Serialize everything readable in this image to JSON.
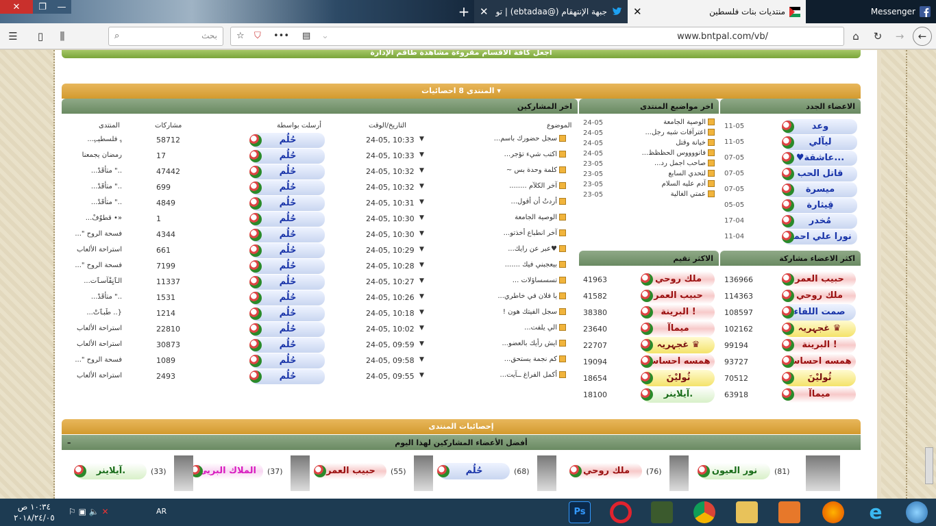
{
  "browser": {
    "tabs": [
      {
        "label": "جبهة الإنتهقام (@ebtadaa) | تو",
        "icon": "twitter-icon"
      },
      {
        "label": "منتديات بنات فلسطين",
        "icon": "palestine-flag-icon"
      },
      {
        "label": "Messenger",
        "icon": "facebook-icon"
      }
    ],
    "search_placeholder": "بحث",
    "url": "www.bntpal.com/vb/"
  },
  "forum": {
    "top_links": "اجعل كافة الأقسام مقروءة    مشاهدة طاقم الإدارة",
    "stats_title": "المنتدى 8 احصائيات",
    "new_members_title": "الاعضاء الجدد",
    "new_members": [
      {
        "name": "وعد",
        "date": "11-05"
      },
      {
        "name": "ليآلي",
        "date": "11-05"
      },
      {
        "name": "♥عاشقة...",
        "date": "07-05"
      },
      {
        "name": "قاتل الحب",
        "date": "07-05"
      },
      {
        "name": "ميسرة",
        "date": "07-05"
      },
      {
        "name": "قِيثارة",
        "date": "05-05"
      },
      {
        "name": "مُخدر",
        "date": "17-04"
      },
      {
        "name": "نورا علي احمد",
        "date": "11-04"
      }
    ],
    "latest_topics_title": "اخر مواضيع المنتدى",
    "latest_topics": [
      {
        "title": "الوصية الجامعة",
        "date": "24-05"
      },
      {
        "title": "اعترآفات شبه رجل...",
        "date": "24-05"
      },
      {
        "title": "خيانة وقتل",
        "date": "24-05"
      },
      {
        "title": "فانووووس الحظظظ...",
        "date": "24-05"
      },
      {
        "title": "صاحب اجمل رد...",
        "date": "23-05"
      },
      {
        "title": "لتحدي السابع",
        "date": "23-05"
      },
      {
        "title": "آدم عليه السلام",
        "date": "23-05"
      },
      {
        "title": "عمتي الغالية",
        "date": "23-05"
      }
    ],
    "last_posters_title": "اخر المشاركين",
    "last_posters_headers": {
      "topic": "الموضوع",
      "datetime": "التاريخ/الوقت",
      "by": "أرسلت بواسطة",
      "posts": "مشاركات",
      "forum": "المنتدى"
    },
    "last_posters": [
      {
        "topic": "سجل حضورك باسم...",
        "time": "24-05, 10:33",
        "by": "حُلُم",
        "posts": "58712",
        "forum": "ﮩ فلسطيـﮩ..."
      },
      {
        "topic": "اكتب شيء تؤجر...",
        "time": "24-05, 10:33",
        "by": "حُلُم",
        "posts": "17",
        "forum": "رمضان يجمعنا"
      },
      {
        "topic": "كلمة وحدة بس ~",
        "time": "24-05, 10:32",
        "by": "حُلُم",
        "posts": "47442",
        "forum": "..\" مٺأقٓدْ..."
      },
      {
        "topic": "آخر الكلآم ........",
        "time": "24-05, 10:32",
        "by": "حُلُم",
        "posts": "699",
        "forum": "..\" مٺأقٓدْ..."
      },
      {
        "topic": "أردتُ أن أقول...",
        "time": "24-05, 10:31",
        "by": "حُلُم",
        "posts": "4849",
        "forum": "..\" مٺأقٓدْ..."
      },
      {
        "topic": "الوصية الجامعة",
        "time": "24-05, 10:30",
        "by": "حُلُم",
        "posts": "1",
        "forum": "«• قطوٌفْ..."
      },
      {
        "topic": "آخر انطباع أخذتو...",
        "time": "24-05, 10:30",
        "by": "حُلُم",
        "posts": "4344",
        "forum": "فسحة الروح \"..."
      },
      {
        "topic": "♥عبر عن رايك...",
        "time": "24-05, 10:29",
        "by": "حُلُم",
        "posts": "661",
        "forum": "استراحة الألعاب"
      },
      {
        "topic": "بيعجبني فيك .......",
        "time": "24-05, 10:28",
        "by": "حُلُم",
        "posts": "7199",
        "forum": "فسحة الروح \"..."
      },
      {
        "topic": "تسسساؤلات ...",
        "time": "24-05, 10:27",
        "by": "حُلُم",
        "posts": "11337",
        "forum": "الٱنٍفْآسٱت..."
      },
      {
        "topic": "يا فلان في خاطري...",
        "time": "24-05, 10:26",
        "by": "حُلُم",
        "posts": "1531",
        "forum": "..\" مٺأقٓدْ..."
      },
      {
        "topic": "سجل الفيتك هون !",
        "time": "24-05, 10:18",
        "by": "حُلُم",
        "posts": "1214",
        "forum": "{.. طَبٱتْ..."
      },
      {
        "topic": "الي يلفت...",
        "time": "24-05, 10:02",
        "by": "حُلُم",
        "posts": "22810",
        "forum": "استراحة الألعاب"
      },
      {
        "topic": "ايش رأيك بالعضو...",
        "time": "24-05, 09:59",
        "by": "حُلُم",
        "posts": "30873",
        "forum": "استراحة الألعاب"
      },
      {
        "topic": "كم نجمة يستحق...",
        "time": "24-05, 09:58",
        "by": "حُلُم",
        "posts": "1089",
        "forum": "فسحة الروح \"..."
      },
      {
        "topic": "أكمل الفراغ ــآيت...",
        "time": "24-05, 09:55",
        "by": "حُلُم",
        "posts": "2493",
        "forum": "استراحة الألعاب"
      }
    ],
    "top_posters_title": "اكثر الاعضاء مشاركة",
    "top_posters": [
      {
        "name": "حبيب العمر",
        "count": "136966",
        "style": "red"
      },
      {
        "name": "ملك روحي",
        "count": "114363",
        "style": "red"
      },
      {
        "name": "صمت اللقاء",
        "count": "108597",
        "style": "blue"
      },
      {
        "name": "غجہريہ ♛",
        "count": "102162",
        "style": "yel"
      },
      {
        "name": "البرينة !",
        "count": "99194",
        "style": "red"
      },
      {
        "name": "همسه احساس",
        "count": "93727",
        "style": "red"
      },
      {
        "name": "ثُوليْنَ",
        "count": "70512",
        "style": "yel"
      },
      {
        "name": "ميماآ",
        "count": "63918",
        "style": "red"
      }
    ],
    "top_rated_title": "الاكثر تقيم",
    "top_rated": [
      {
        "name": "ملك روحي",
        "count": "41963",
        "style": "red"
      },
      {
        "name": "حبيب العمر",
        "count": "41582",
        "style": "red"
      },
      {
        "name": "البرينة !",
        "count": "38380",
        "style": "red"
      },
      {
        "name": "ميماآ",
        "count": "23640",
        "style": "red"
      },
      {
        "name": "غجہريہ ♛",
        "count": "22707",
        "style": "yel"
      },
      {
        "name": "همسه احساس",
        "count": "19094",
        "style": "red"
      },
      {
        "name": "ثُوليْنَ",
        "count": "18654",
        "style": "yel"
      },
      {
        "name": "آيلاينر.",
        "count": "18100",
        "style": "grn"
      }
    ],
    "forum_stats_title": "إحصائيات المنتدى",
    "best_today_title": "أفضل الأعضاء المشاركين لهذا اليوم",
    "best_today": [
      {
        "name": "نور العيون",
        "count": "(81)"
      },
      {
        "name": "ملك روحي",
        "count": "(76)"
      },
      {
        "name": "حُلُم",
        "count": "(68)"
      },
      {
        "name": "حبيب العمر",
        "count": "(55)"
      },
      {
        "name": "الملاك البريئ",
        "count": "(37)"
      },
      {
        "name": "آيلاينر.",
        "count": "(33)"
      }
    ]
  },
  "taskbar": {
    "language": "AR",
    "time": "١٠:٣٤ ص",
    "date": "٢٠١٨/٢٤/٠٥"
  }
}
